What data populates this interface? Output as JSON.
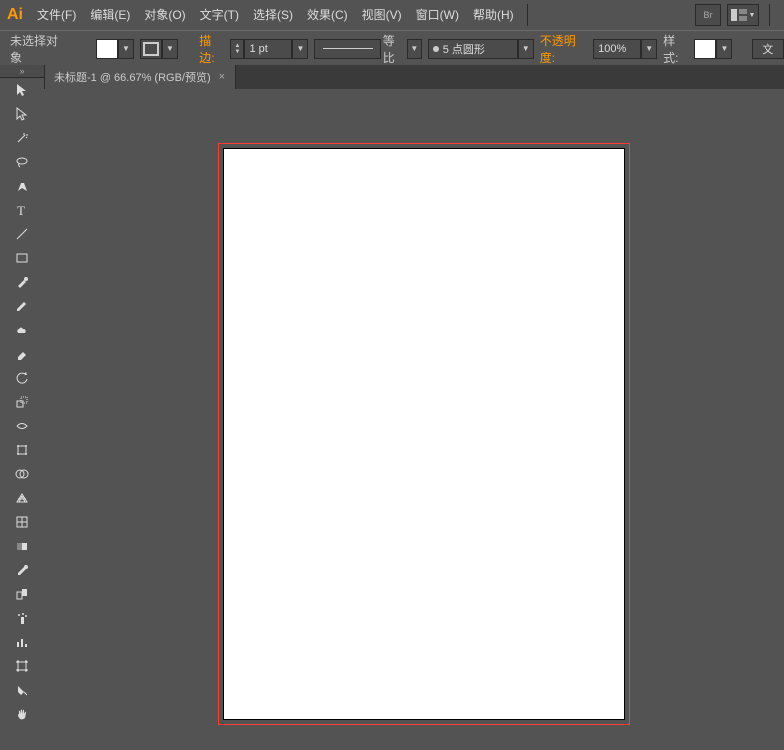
{
  "app_logo": "Ai",
  "menus": {
    "file": "文件(F)",
    "edit": "编辑(E)",
    "object": "对象(O)",
    "type": "文字(T)",
    "select": "选择(S)",
    "effect": "效果(C)",
    "view": "视图(V)",
    "window": "窗口(W)",
    "help": "帮助(H)"
  },
  "menubar_right": {
    "br": "Br"
  },
  "options": {
    "no_selection": "未选择对象",
    "stroke_label": "描边:",
    "stroke_value": "1 pt",
    "uniform_label": "等比",
    "brush_text": "5 点圆形",
    "opacity_label": "不透明度:",
    "opacity_value": "100%",
    "style_label": "样式:",
    "doc_btn": "文"
  },
  "tab": {
    "title": "未标题-1 @ 66.67% (RGB/预览)",
    "close": "×"
  }
}
